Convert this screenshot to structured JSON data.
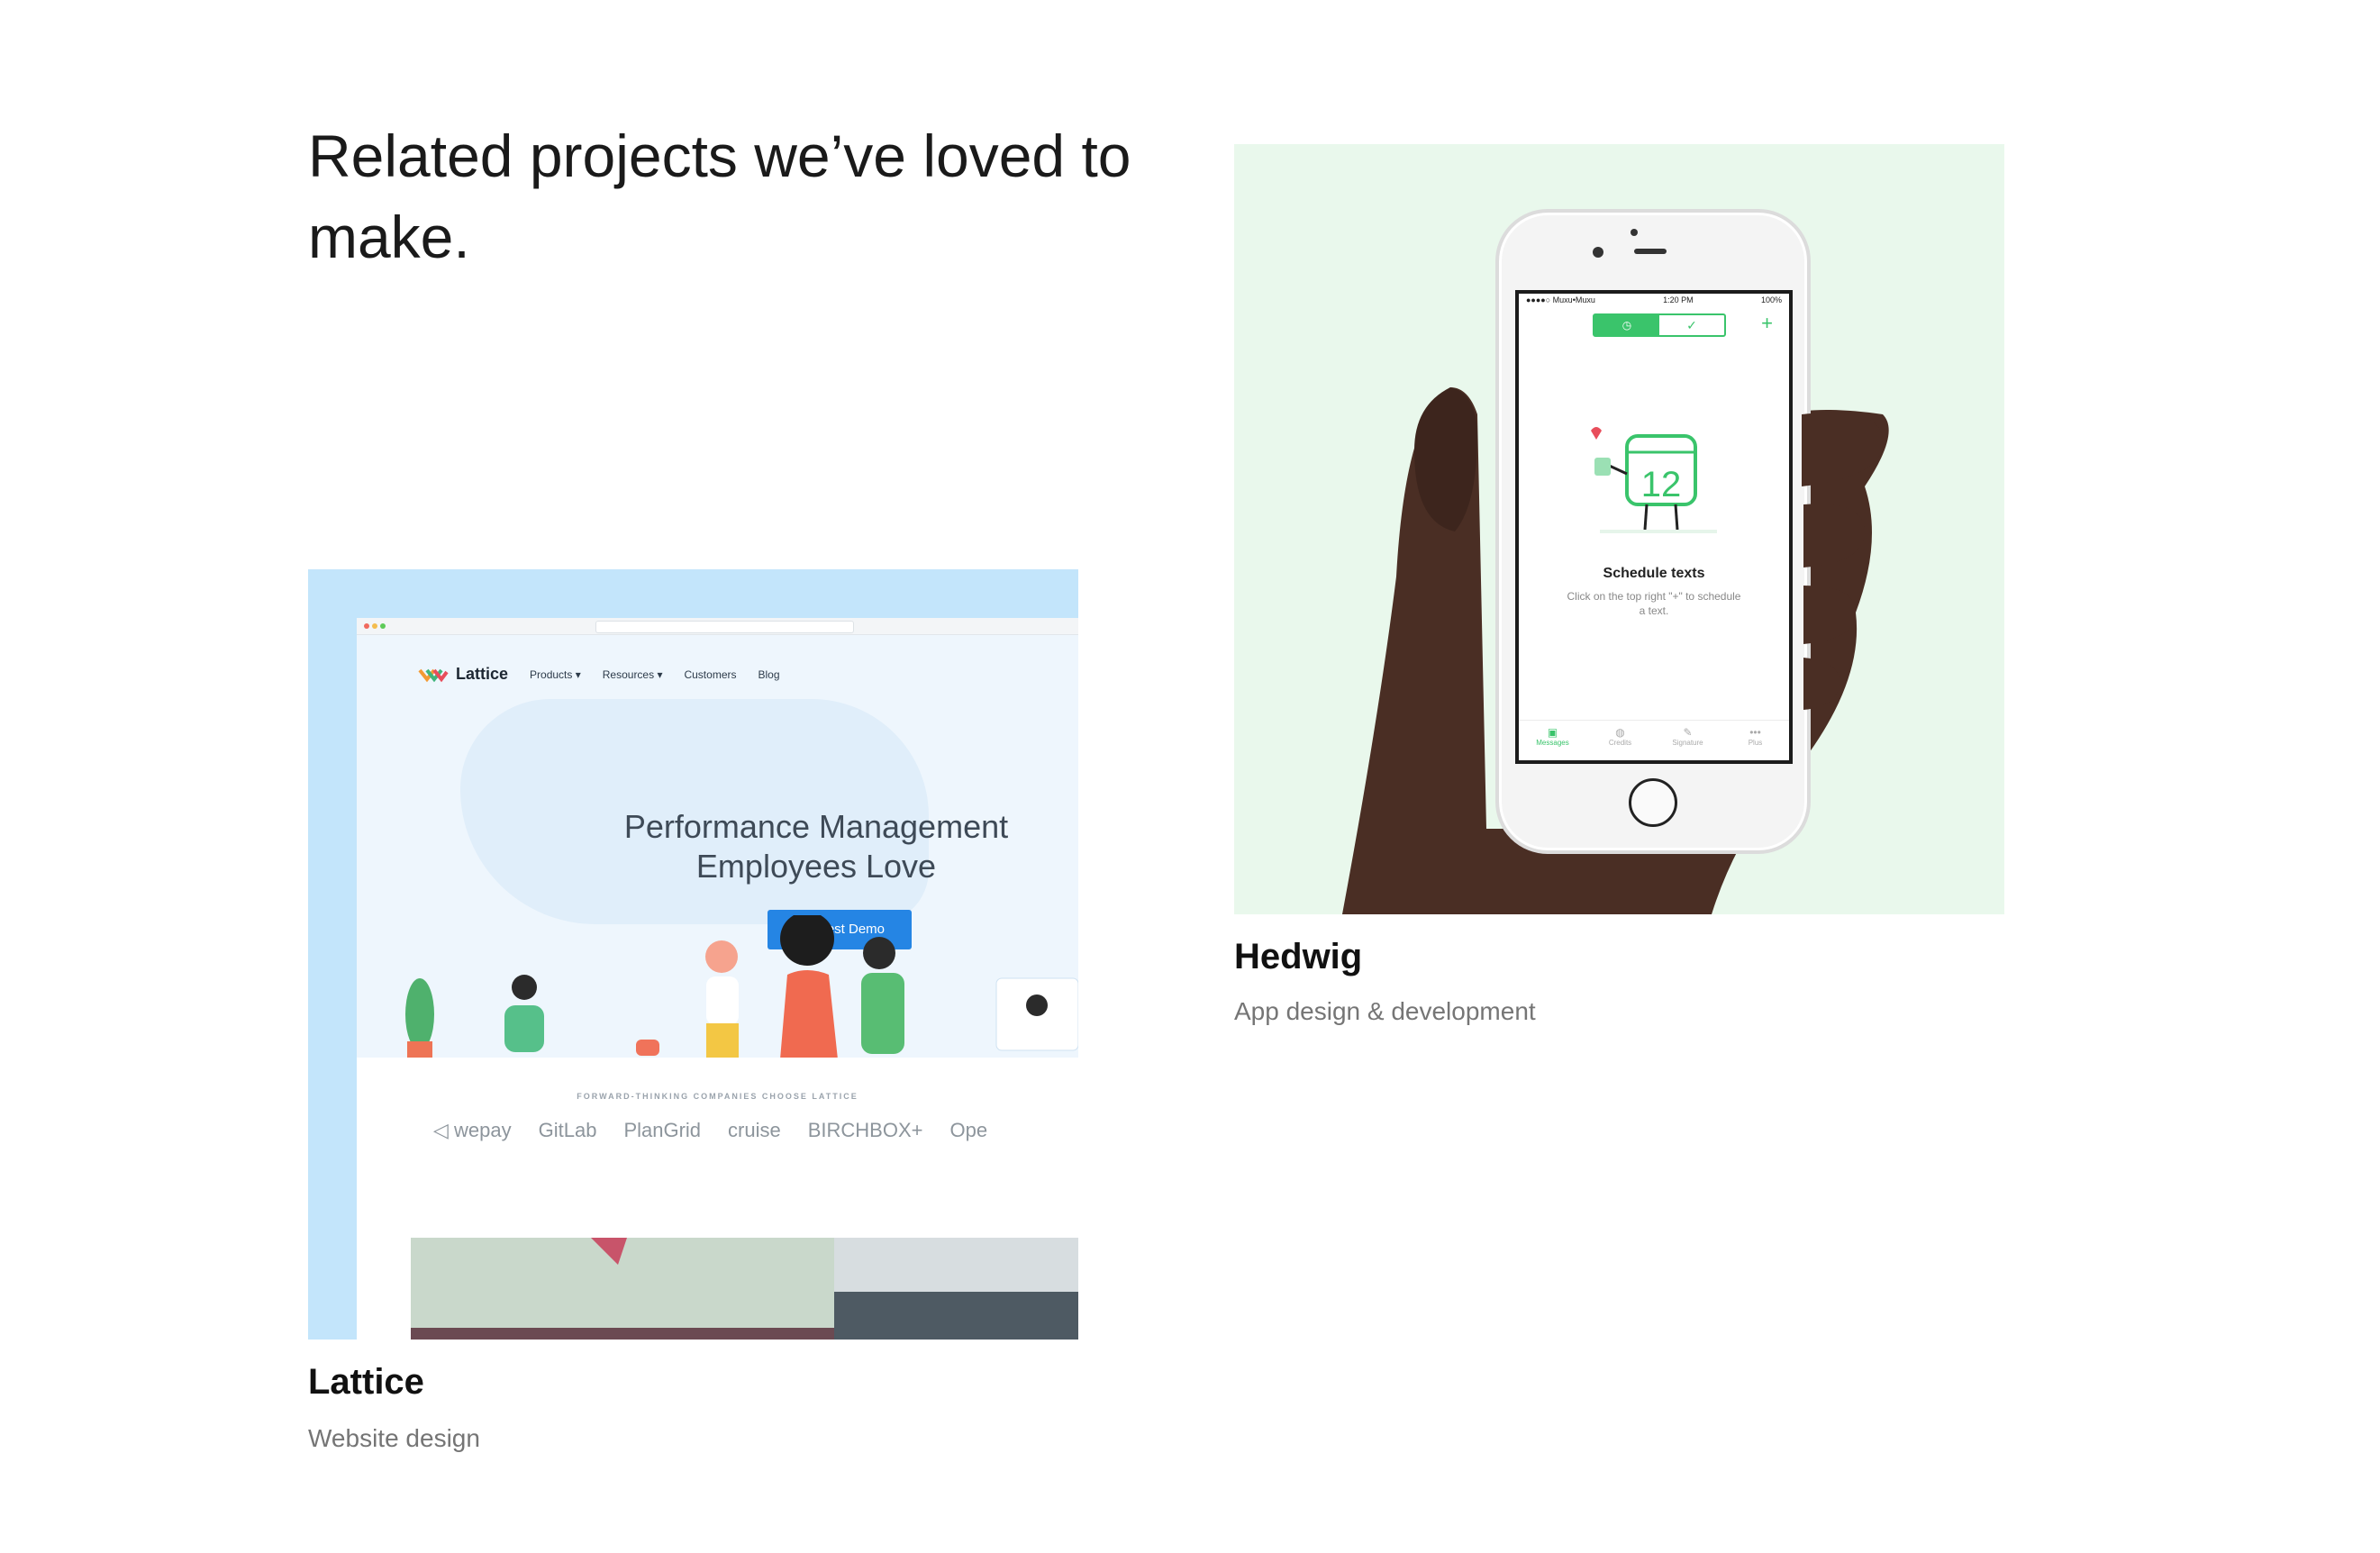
{
  "section": {
    "heading": "Related projects we’ve loved to make."
  },
  "projects": [
    {
      "title": "Lattice",
      "subtitle": "Website design",
      "mock": {
        "logo": "Lattice",
        "nav": [
          "Products ▾",
          "Resources ▾",
          "Customers",
          "Blog"
        ],
        "hero_title": "Performance Management Employees Love",
        "cta": "Request Demo",
        "logos_caption": "FORWARD-THINKING COMPANIES CHOOSE LATTICE",
        "logos": [
          "◁ wepay",
          "GitLab",
          "PlanGrid",
          "cruise",
          "BIRCHBOX+",
          "Ope"
        ],
        "accent": "#2585e4",
        "background": "#c3e5fb"
      }
    },
    {
      "title": "Hedwig",
      "subtitle": "App design & development",
      "mock": {
        "status_carrier": "●●●●○ Muxu•Muxu",
        "status_time": "1:20 PM",
        "status_battery": "100%",
        "calendar_number": "12",
        "headline": "Schedule texts",
        "body": "Click on the top right \"+\" to schedule a text.",
        "tabs": [
          "Messages",
          "Credits",
          "Signature",
          "Plus"
        ],
        "accent": "#3ac46b",
        "background": "#e9f8ec"
      }
    }
  ]
}
